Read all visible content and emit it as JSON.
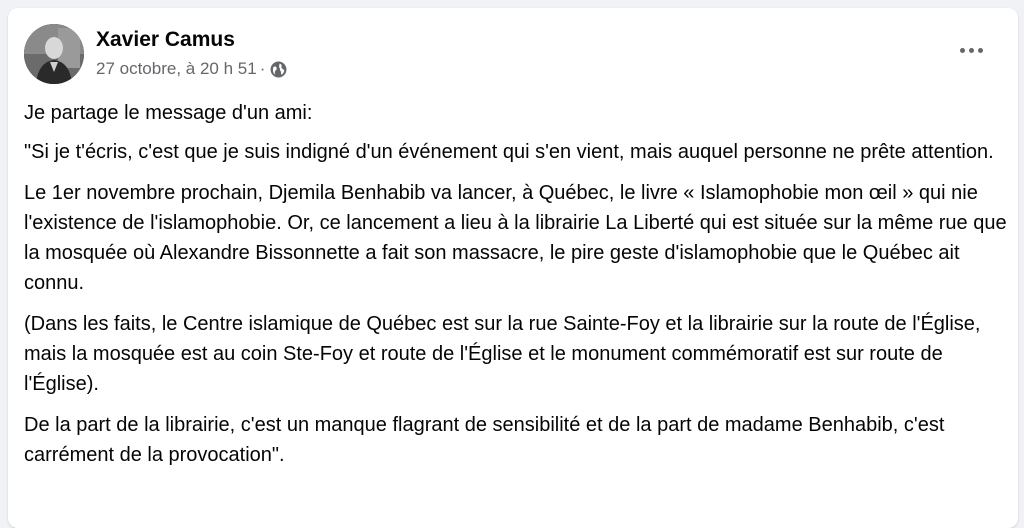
{
  "post": {
    "author": "Xavier Camus",
    "timestamp": "27 octobre, à 20 h 51",
    "separator": "·",
    "audience_icon": "globe-icon",
    "more_icon": "more-options-icon",
    "paragraphs": [
      "Je partage le message d'un ami:",
      "\"Si je t'écris, c'est que je suis indigné d'un événement qui s'en vient, mais auquel personne ne prête attention.",
      "Le 1er novembre prochain, Djemila Benhabib va lancer, à Québec, le livre « Islamophobie mon œil » qui nie l'existence de l'islamophobie. Or, ce lancement a lieu à la librairie La Liberté qui est située sur la même rue que la mosquée où Alexandre Bissonnette a fait son massacre, le pire geste d'islamophobie que le Québec ait connu.",
      "(Dans les faits, le Centre islamique de Québec est sur la rue Sainte-Foy et la librairie sur la route de l'Église, mais la mosquée est au coin Ste-Foy et route de l'Église et le monument commémoratif est sur route de l'Église).",
      "De la part de la librairie, c'est un manque flagrant de sensibilité et de la part de madame Benhabib, c'est carrément de la provocation\"."
    ]
  },
  "colors": {
    "background": "#f0f2f5",
    "card": "#ffffff",
    "text_primary": "#050505",
    "text_secondary": "#65676b"
  }
}
